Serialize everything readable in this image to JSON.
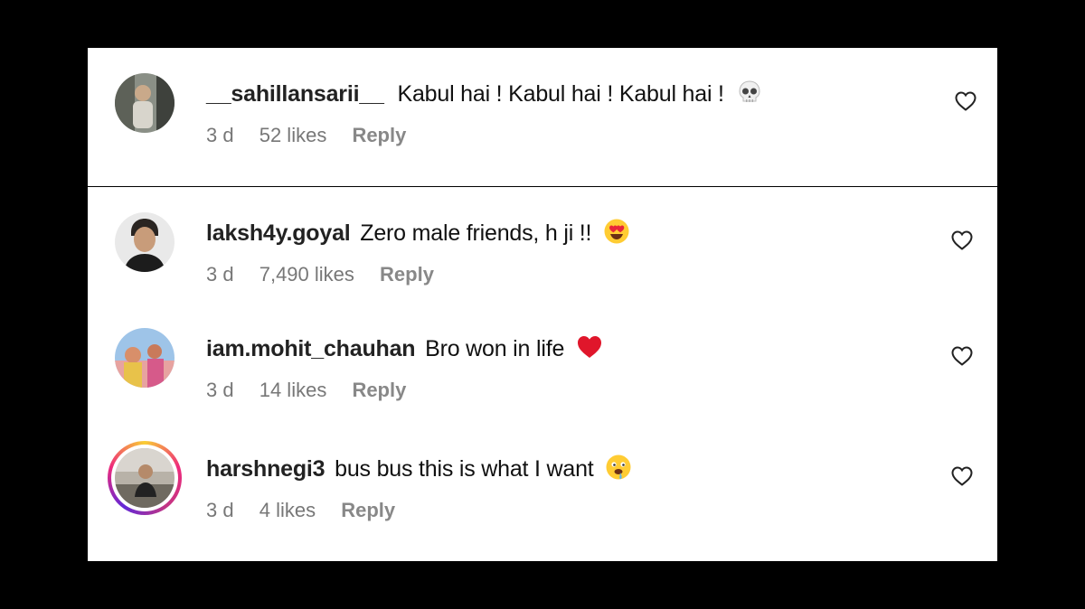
{
  "comments": [
    {
      "username": "__sahillansarii__",
      "text": "Kabul hai ! Kabul hai ! Kabul hai !",
      "emoji": "skull-emoji",
      "age": "3 d",
      "likes": "52 likes",
      "reply_label": "Reply"
    },
    {
      "username": "laksh4y.goyal",
      "text": "Zero male friends, h ji !!",
      "emoji": "heart-eyes-emoji",
      "age": "3 d",
      "likes": "7,490 likes",
      "reply_label": "Reply"
    },
    {
      "username": "iam.mohit_chauhan",
      "text": "Bro won in life",
      "emoji": "red-heart-emoji",
      "age": "3 d",
      "likes": "14 likes",
      "reply_label": "Reply"
    },
    {
      "username": "harshnegi3",
      "text": "bus bus this is what I want",
      "emoji": "drooling-face-emoji",
      "age": "3 d",
      "likes": "4 likes",
      "reply_label": "Reply"
    }
  ],
  "colors": {
    "background": "#000000",
    "card": "#ffffff",
    "meta_text": "#777777",
    "story_ring": [
      "#f9ce34",
      "#ee2a7b",
      "#6228d7"
    ]
  }
}
